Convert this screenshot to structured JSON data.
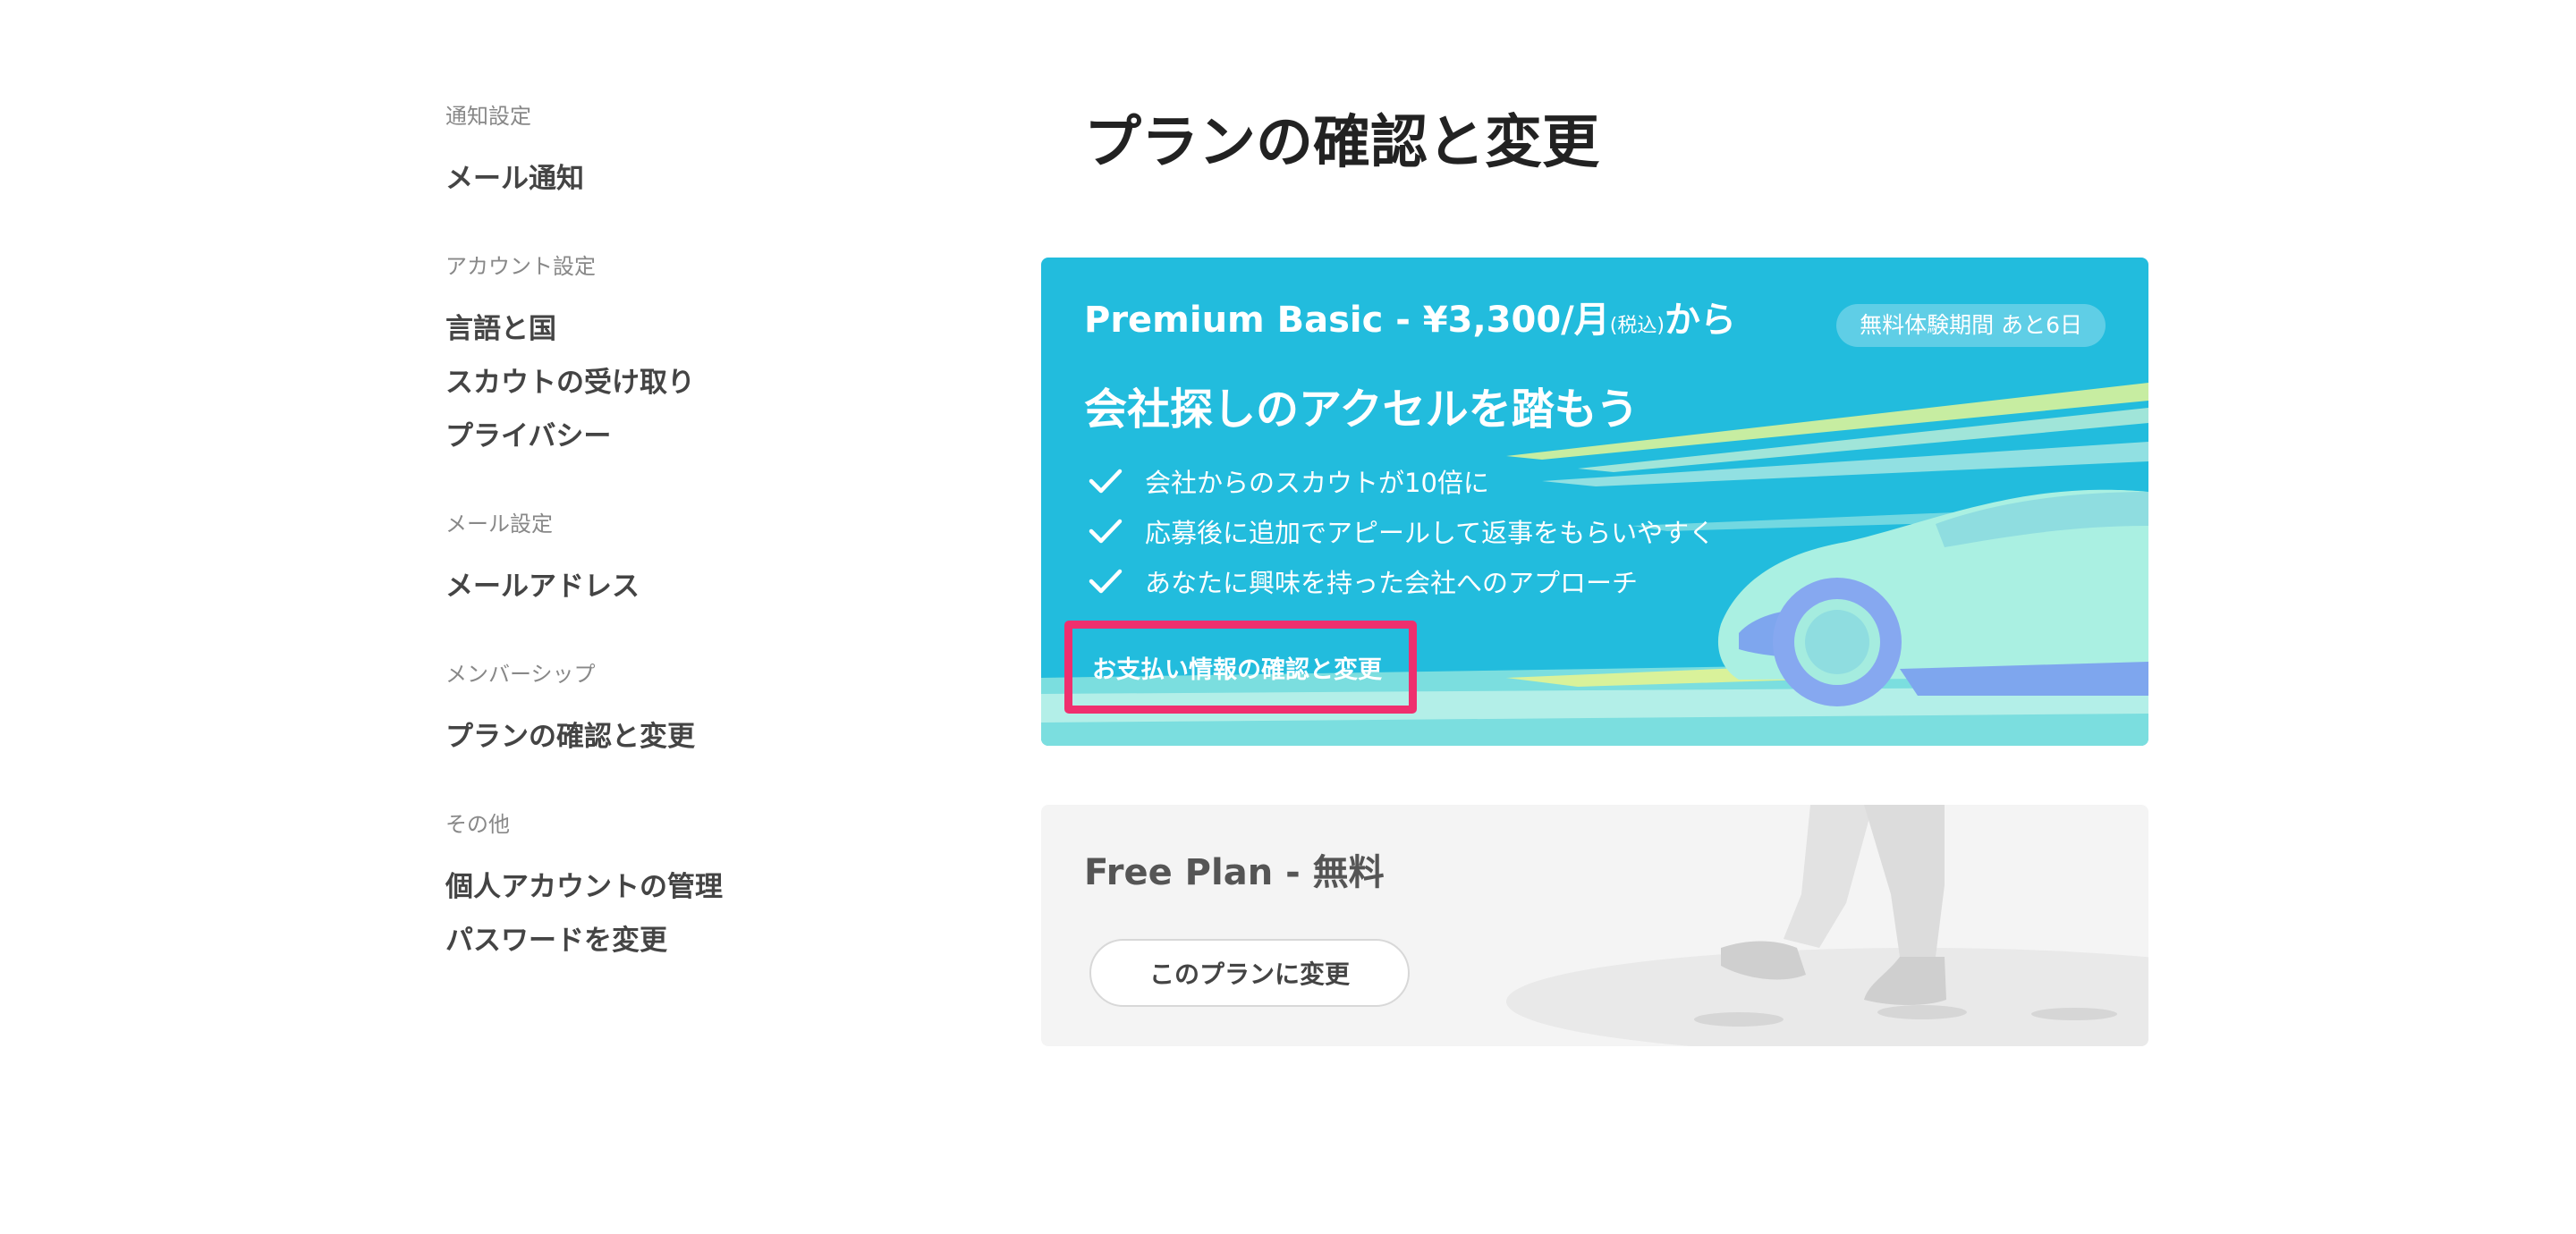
{
  "sidebar": {
    "groups": [
      {
        "heading": "通知設定",
        "items": [
          "メール通知"
        ]
      },
      {
        "heading": "アカウント設定",
        "items": [
          "言語と国",
          "スカウトの受け取り",
          "プライバシー"
        ]
      },
      {
        "heading": "メール設定",
        "items": [
          "メールアドレス"
        ]
      },
      {
        "heading": "メンバーシップ",
        "items": [
          "プランの確認と変更"
        ]
      },
      {
        "heading": "その他",
        "items": [
          "個人アカウントの管理",
          "パスワードを変更"
        ]
      }
    ]
  },
  "main": {
    "title": "プランの確認と変更"
  },
  "premium": {
    "price_main": "Premium Basic - ¥3,300/月",
    "price_tax": "(税込)",
    "price_suffix": "から",
    "trial_badge": "無料体験期間 あと6日",
    "headline": "会社探しのアクセルを踏もう",
    "features": [
      "会社からのスカウトが10倍に",
      "応募後に追加でアピールして返事をもらいやすく",
      "あなたに興味を持った会社へのアプローチ"
    ],
    "payment_link": "お支払い情報の確認と変更"
  },
  "free": {
    "title": "Free Plan - 無料",
    "button_label": "このプランに変更"
  },
  "colors": {
    "premium_bg": "#22bcdd",
    "highlight": "#ef2f6e",
    "free_bg": "#f4f4f4"
  },
  "icons": {
    "feature_check": "check-icon"
  }
}
